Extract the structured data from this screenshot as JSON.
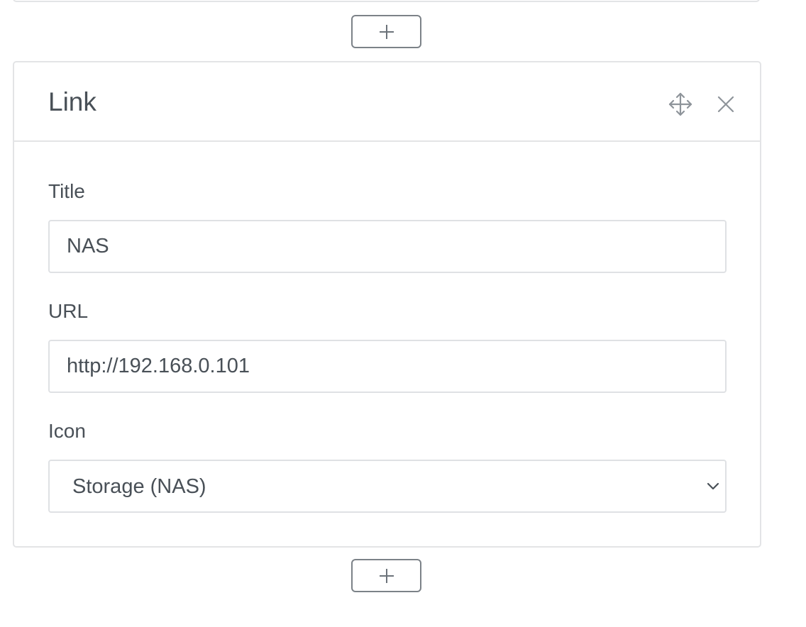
{
  "add_buttons": [
    {
      "label": "+"
    },
    {
      "label": "+"
    }
  ],
  "card": {
    "title": "Link",
    "move_icon": "move-icon",
    "close_icon": "close-icon"
  },
  "fields": {
    "title": {
      "label": "Title",
      "value": "NAS"
    },
    "url": {
      "label": "URL",
      "value": "http://192.168.0.101"
    },
    "icon": {
      "label": "Icon",
      "selected": "Storage (NAS)",
      "chevron_icon": "chevron-down-icon"
    }
  },
  "colors": {
    "text": "#495057",
    "border": "#e3e4e6",
    "button_border": "#7c8288",
    "icon_gray": "#8e949a"
  }
}
